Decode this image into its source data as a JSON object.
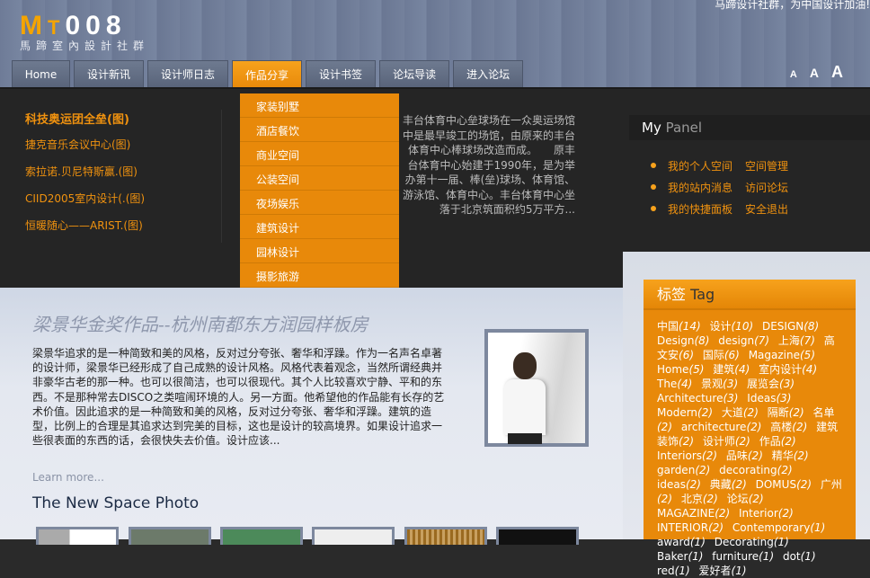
{
  "header": {
    "slogan": "马蹄设计社群，为中国设计加油!",
    "logo_text": "MT008",
    "logo_sub": "馬蹄室內設計社群"
  },
  "nav": {
    "tabs": [
      "Home",
      "设计新讯",
      "设计师日志",
      "作品分享",
      "设计书签",
      "论坛导读",
      "进入论坛"
    ],
    "active": 3,
    "font_sizes": [
      "A",
      "A",
      "A"
    ]
  },
  "dropdown": [
    "家装别墅",
    "酒店餐饮",
    "商业空间",
    "公装空间",
    "夜场娱乐",
    "建筑设计",
    "园林设计",
    "摄影旅游"
  ],
  "news": [
    "科技奥运团全垒(图)",
    "捷克音乐会议中心(图)",
    "索拉诺.贝尼特斯赢.(图)",
    "CIID2005室内设计(.(图)",
    "恒暖随心——ARIST.(图)"
  ],
  "feature_text": "丰台体育中心垒球场在一众奥运场馆中是最早竣工的场馆，由原来的丰台体育中心棒球场改造而成。　　原丰台体育中心始建于1990年，是为举办第十一届、棒(垒)球场、体育馆、游泳馆、体育中心。丰台体育中心坐落于北京筑面积约5万平方...",
  "panel": {
    "title_a": "My",
    "title_b": "Panel",
    "rows": [
      [
        "我的个人空间",
        "空间管理"
      ],
      [
        "我的站内消息",
        "访问论坛"
      ],
      [
        "我的快捷面板",
        "安全退出"
      ]
    ]
  },
  "article": {
    "title": "梁景华金奖作品--杭州南都东方润园样板房",
    "body": "梁景华追求的是一种简致和美的风格，反对过分夸张、奢华和浮躁。作为一名声名卓著的设计师，梁景华已经形成了自己成熟的设计风格。风格代表着观念，当然所谓经典并非豪华古老的那一种。也可以很简洁，也可以很现代。其个人比较喜欢宁静、平和的东西。不是那种常去DISCO之类喧闹环境的人。另一方面。他希望他的作品能有长存的艺术价值。因此追求的是一种简致和美的风格，反对过分夸张、奢华和浮躁。建筑的造型，比例上的合理是其追求达到完美的目标，这也是设计的较高境界。如果设计追求一些很表面的东西的话，会很快失去价值。设计应该...",
    "learn_more": "Learn more...",
    "photos_title": "The New Space Photo"
  },
  "tags": {
    "title_a": "标签",
    "title_b": "Tag",
    "items": [
      [
        "中国",
        "(14)"
      ],
      [
        "设计",
        "(10)"
      ],
      [
        "DESIGN",
        "(8)"
      ],
      [
        "Design",
        "(8)"
      ],
      [
        "design",
        "(7)"
      ],
      [
        "上海",
        "(7)"
      ],
      [
        "高文安",
        "(6)"
      ],
      [
        "国际",
        "(6)"
      ],
      [
        "Magazine",
        "(5)"
      ],
      [
        "Home",
        "(5)"
      ],
      [
        "建筑",
        "(4)"
      ],
      [
        "室内设计",
        "(4)"
      ],
      [
        "The",
        "(4)"
      ],
      [
        "景观",
        "(3)"
      ],
      [
        "展览会",
        "(3)"
      ],
      [
        "Architecture",
        "(3)"
      ],
      [
        "Ideas",
        "(3)"
      ],
      [
        "Modern",
        "(2)"
      ],
      [
        "大道",
        "(2)"
      ],
      [
        "隔断",
        "(2)"
      ],
      [
        "名单",
        "(2)"
      ],
      [
        "architecture",
        "(2)"
      ],
      [
        "高楼",
        "(2)"
      ],
      [
        "建筑装饰",
        "(2)"
      ],
      [
        "设计师",
        "(2)"
      ],
      [
        "作品",
        "(2)"
      ],
      [
        "Interiors",
        "(2)"
      ],
      [
        "品味",
        "(2)"
      ],
      [
        "精华",
        "(2)"
      ],
      [
        "garden",
        "(2)"
      ],
      [
        "decorating",
        "(2)"
      ],
      [
        "ideas",
        "(2)"
      ],
      [
        "典藏",
        "(2)"
      ],
      [
        "DOMUS",
        "(2)"
      ],
      [
        "广州",
        "(2)"
      ],
      [
        "北京",
        "(2)"
      ],
      [
        "论坛",
        "(2)"
      ],
      [
        "MAGAZINE",
        "(2)"
      ],
      [
        "Interior",
        "(2)"
      ],
      [
        "INTERIOR",
        "(2)"
      ],
      [
        "Contemporary",
        "(1)"
      ],
      [
        "award",
        "(1)"
      ],
      [
        "Decorating",
        "(1)"
      ],
      [
        "Baker",
        "(1)"
      ],
      [
        "furniture",
        "(1)"
      ],
      [
        "dot",
        "(1)"
      ],
      [
        "red",
        "(1)"
      ],
      [
        "爱好者",
        "(1)"
      ]
    ]
  }
}
